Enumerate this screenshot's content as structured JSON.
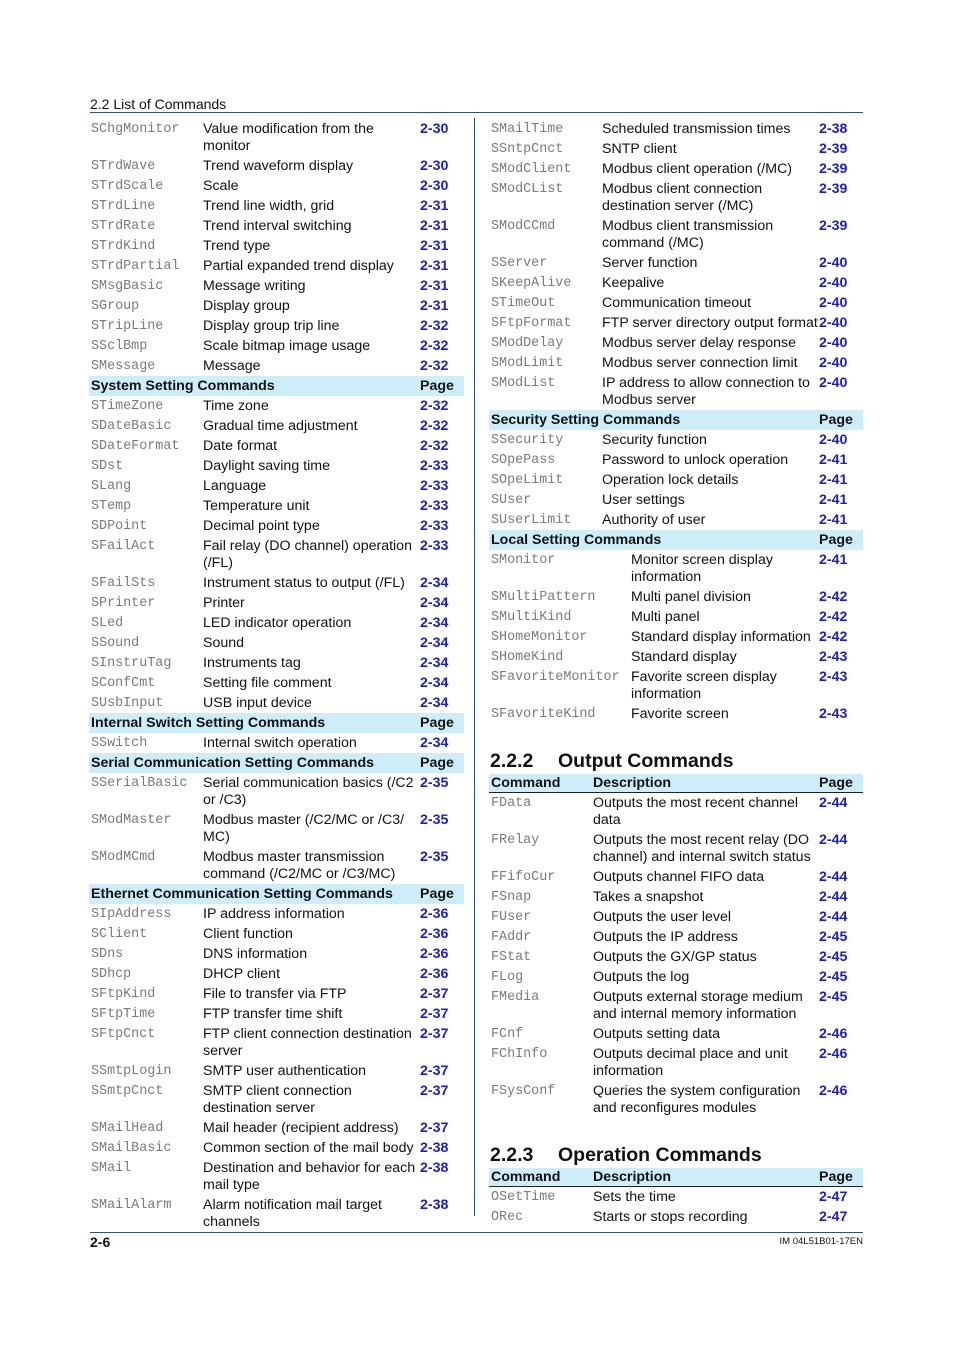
{
  "header": {
    "running_title": "2.2  List of Commands"
  },
  "left_column": {
    "groups": [
      {
        "title": null,
        "rows": [
          {
            "cmd": "SChgMonitor",
            "desc": "Value modification from the monitor",
            "page": "2-30"
          },
          {
            "cmd": "STrdWave",
            "desc": "Trend waveform display",
            "page": "2-30"
          },
          {
            "cmd": "STrdScale",
            "desc": "Scale",
            "page": "2-30"
          },
          {
            "cmd": "STrdLine",
            "desc": "Trend line width, grid",
            "page": "2-31"
          },
          {
            "cmd": "STrdRate",
            "desc": "Trend interval switching",
            "page": "2-31"
          },
          {
            "cmd": "STrdKind",
            "desc": "Trend type",
            "page": "2-31"
          },
          {
            "cmd": "STrdPartial",
            "desc": "Partial expanded trend display",
            "page": "2-31"
          },
          {
            "cmd": "SMsgBasic",
            "desc": "Message writing",
            "page": "2-31"
          },
          {
            "cmd": "SGroup",
            "desc": "Display group",
            "page": "2-31"
          },
          {
            "cmd": "STripLine",
            "desc": "Display group trip line",
            "page": "2-32"
          },
          {
            "cmd": "SSclBmp",
            "desc": "Scale bitmap image usage",
            "page": "2-32"
          },
          {
            "cmd": "SMessage",
            "desc": "Message",
            "page": "2-32"
          }
        ]
      },
      {
        "title": "System Setting Commands",
        "page_label": "Page",
        "rows": [
          {
            "cmd": "STimeZone",
            "desc": "Time zone",
            "page": "2-32"
          },
          {
            "cmd": "SDateBasic",
            "desc": "Gradual time adjustment",
            "page": "2-32"
          },
          {
            "cmd": "SDateFormat",
            "desc": "Date format",
            "page": "2-32"
          },
          {
            "cmd": "SDst",
            "desc": "Daylight saving time",
            "page": "2-33"
          },
          {
            "cmd": "SLang",
            "desc": "Language",
            "page": "2-33"
          },
          {
            "cmd": "STemp",
            "desc": "Temperature unit",
            "page": "2-33"
          },
          {
            "cmd": "SDPoint",
            "desc": "Decimal point type",
            "page": "2-33"
          },
          {
            "cmd": "SFailAct",
            "desc": "Fail relay (DO channel) operation (/FL)",
            "page": "2-33"
          },
          {
            "cmd": "SFailSts",
            "desc": "Instrument status to output (/FL)",
            "page": "2-34"
          },
          {
            "cmd": "SPrinter",
            "desc": "Printer",
            "page": "2-34"
          },
          {
            "cmd": "SLed",
            "desc": "LED indicator operation",
            "page": "2-34"
          },
          {
            "cmd": "SSound",
            "desc": "Sound",
            "page": "2-34"
          },
          {
            "cmd": "SInstruTag",
            "desc": "Instruments tag",
            "page": "2-34"
          },
          {
            "cmd": "SConfCmt",
            "desc": "Setting file comment",
            "page": "2-34"
          },
          {
            "cmd": "SUsbInput",
            "desc": "USB input device",
            "page": "2-34"
          }
        ]
      },
      {
        "title": "Internal Switch Setting Commands",
        "page_label": "Page",
        "rows": [
          {
            "cmd": "SSwitch",
            "desc": "Internal switch operation",
            "page": "2-34"
          }
        ]
      },
      {
        "title": "Serial Communication Setting Commands",
        "page_label": "Page",
        "rows": [
          {
            "cmd": "SSerialBasic",
            "desc": "Serial communication basics (/C2 or /C3)",
            "page": "2-35"
          },
          {
            "cmd": "SModMaster",
            "desc": "Modbus master (/C2/MC or /C3/ MC)",
            "page": "2-35"
          },
          {
            "cmd": "SModMCmd",
            "desc": "Modbus master transmission command (/C2/MC or /C3/MC)",
            "page": "2-35"
          }
        ]
      },
      {
        "title": "Ethernet Communication Setting Commands",
        "page_label": "Page",
        "rows": [
          {
            "cmd": "SIpAddress",
            "desc": "IP address information",
            "page": "2-36"
          },
          {
            "cmd": "SClient",
            "desc": "Client function",
            "page": "2-36"
          },
          {
            "cmd": "SDns",
            "desc": "DNS information",
            "page": "2-36"
          },
          {
            "cmd": "SDhcp",
            "desc": "DHCP client",
            "page": "2-36"
          },
          {
            "cmd": "SFtpKind",
            "desc": "File to transfer via FTP",
            "page": "2-37"
          },
          {
            "cmd": "SFtpTime",
            "desc": "FTP transfer time shift",
            "page": "2-37"
          },
          {
            "cmd": "SFtpCnct",
            "desc": "FTP client connection destination server",
            "page": "2-37"
          },
          {
            "cmd": "SSmtpLogin",
            "desc": "SMTP user authentication",
            "page": "2-37"
          },
          {
            "cmd": "SSmtpCnct",
            "desc": "SMTP client connection destination server",
            "page": "2-37"
          },
          {
            "cmd": "SMailHead",
            "desc": "Mail header (recipient address)",
            "page": "2-37"
          },
          {
            "cmd": "SMailBasic",
            "desc": "Common section of the mail body",
            "page": "2-38"
          },
          {
            "cmd": "SMail",
            "desc": "Destination and behavior for each mail type",
            "page": "2-38"
          },
          {
            "cmd": "SMailAlarm",
            "desc": "Alarm notification mail target channels",
            "page": "2-38"
          }
        ]
      }
    ]
  },
  "right_column": {
    "groups": [
      {
        "title": null,
        "rows": [
          {
            "cmd": "SMailTime",
            "desc": "Scheduled transmission times",
            "page": "2-38"
          },
          {
            "cmd": "SSntpCnct",
            "desc": "SNTP client",
            "page": "2-39"
          },
          {
            "cmd": "SModClient",
            "desc": "Modbus client operation (/MC)",
            "page": "2-39"
          },
          {
            "cmd": "SModCList",
            "desc": "Modbus client connection destination server (/MC)",
            "page": "2-39"
          },
          {
            "cmd": "SModCCmd",
            "desc": "Modbus client transmission command (/MC)",
            "page": "2-39"
          },
          {
            "cmd": "SServer",
            "desc": "Server function",
            "page": "2-40"
          },
          {
            "cmd": "SKeepAlive",
            "desc": "Keepalive",
            "page": "2-40"
          },
          {
            "cmd": "STimeOut",
            "desc": "Communication timeout",
            "page": "2-40"
          },
          {
            "cmd": "SFtpFormat",
            "desc": "FTP server directory output format",
            "page": "2-40"
          },
          {
            "cmd": "SModDelay",
            "desc": "Modbus server delay response",
            "page": "2-40"
          },
          {
            "cmd": "SModLimit",
            "desc": "Modbus server connection limit",
            "page": "2-40"
          },
          {
            "cmd": "SModList",
            "desc": "IP address to allow connection to Modbus server",
            "page": "2-40"
          }
        ]
      },
      {
        "title": "Security Setting Commands",
        "page_label": "Page",
        "rows": [
          {
            "cmd": "SSecurity",
            "desc": "Security function",
            "page": "2-40"
          },
          {
            "cmd": "SOpePass",
            "desc": "Password to unlock operation",
            "page": "2-41"
          },
          {
            "cmd": "SOpeLimit",
            "desc": "Operation lock details",
            "page": "2-41"
          },
          {
            "cmd": "SUser",
            "desc": "User settings",
            "page": "2-41"
          },
          {
            "cmd": "SUserLimit",
            "desc": "Authority of user",
            "page": "2-41"
          }
        ]
      },
      {
        "title": "Local Setting Commands",
        "page_label": "Page",
        "rows": [
          {
            "cmd": "SMonitor",
            "desc": "Monitor screen display information",
            "page": "2-41"
          },
          {
            "cmd": "SMultiPattern",
            "desc": "Multi panel division",
            "page": "2-42"
          },
          {
            "cmd": "SMultiKind",
            "desc": "Multi panel",
            "page": "2-42"
          },
          {
            "cmd": "SHomeMonitor",
            "desc": "Standard display information",
            "page": "2-42"
          },
          {
            "cmd": "SHomeKind",
            "desc": "Standard display",
            "page": "2-43"
          },
          {
            "cmd": "SFavoriteMonitor",
            "desc": "Favorite screen display information",
            "page": "2-43"
          },
          {
            "cmd": "SFavoriteKind",
            "desc": "Favorite screen",
            "page": "2-43"
          }
        ]
      }
    ],
    "output_section": {
      "number": "2.2.2",
      "title": "Output Commands",
      "headers": {
        "command": "Command",
        "description": "Description",
        "page": "Page"
      },
      "rows": [
        {
          "cmd": "FData",
          "desc": "Outputs the most recent channel data",
          "page": "2-44"
        },
        {
          "cmd": "FRelay",
          "desc": "Outputs the most recent relay (DO channel) and internal switch status",
          "page": "2-44"
        },
        {
          "cmd": "FFifoCur",
          "desc": "Outputs channel FIFO data",
          "page": "2-44"
        },
        {
          "cmd": "FSnap",
          "desc": "Takes a snapshot",
          "page": "2-44"
        },
        {
          "cmd": "FUser",
          "desc": "Outputs the user level",
          "page": "2-44"
        },
        {
          "cmd": "FAddr",
          "desc": "Outputs the IP address",
          "page": "2-45"
        },
        {
          "cmd": "FStat",
          "desc": "Outputs the GX/GP status",
          "page": "2-45"
        },
        {
          "cmd": "FLog",
          "desc": "Outputs the log",
          "page": "2-45"
        },
        {
          "cmd": "FMedia",
          "desc": "Outputs external storage medium and internal memory information",
          "page": "2-45"
        },
        {
          "cmd": "FCnf",
          "desc": "Outputs setting data",
          "page": "2-46"
        },
        {
          "cmd": "FChInfo",
          "desc": "Outputs decimal place and unit information",
          "page": "2-46"
        },
        {
          "cmd": "FSysConf",
          "desc": "Queries the system configuration and reconfigures modules",
          "page": "2-46"
        }
      ]
    },
    "operation_section": {
      "number": "2.2.3",
      "title": "Operation Commands",
      "headers": {
        "command": "Command",
        "description": "Description",
        "page": "Page"
      },
      "rows": [
        {
          "cmd": "OSetTime",
          "desc": "Sets the time",
          "page": "2-47"
        },
        {
          "cmd": "ORec",
          "desc": "Starts or stops recording",
          "page": "2-47"
        }
      ]
    }
  },
  "footer": {
    "page_number": "2-6",
    "doc_id": "IM 04L51B01-17EN"
  },
  "colors": {
    "rule": "#2a4f9a",
    "band": "#cdeef9",
    "page_link": "#1a1adb",
    "command_text": "#7a7a7a"
  }
}
